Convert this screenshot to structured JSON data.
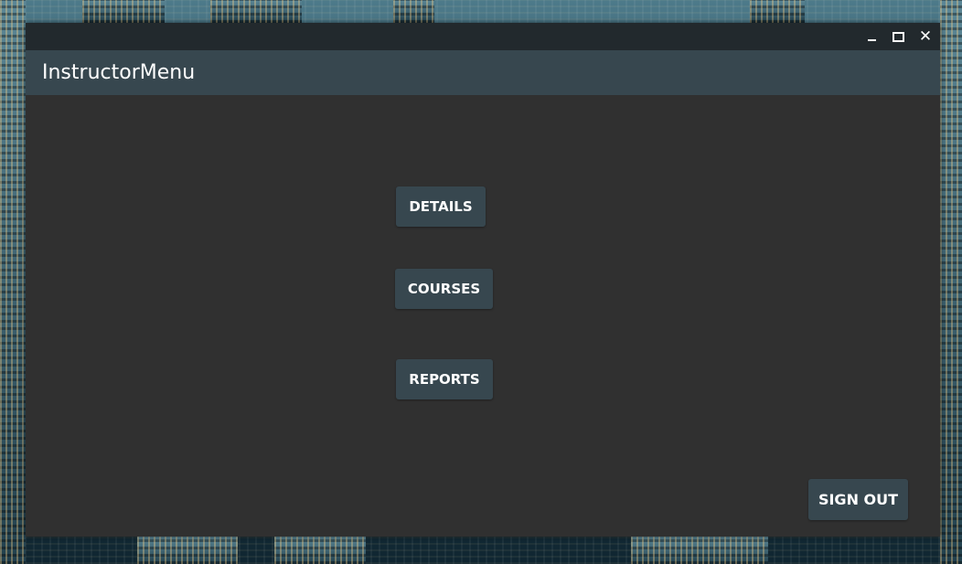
{
  "window": {
    "title": "InstructorMenu",
    "controls": {
      "minimize": "minimize",
      "maximize": "maximize",
      "close": "close"
    }
  },
  "menu": {
    "details_label": "DETAILS",
    "courses_label": "COURSES",
    "reports_label": "REPORTS"
  },
  "footer": {
    "signout_label": "SIGN OUT"
  },
  "colors": {
    "titlebar": "#22292d",
    "appbar": "#37474f",
    "content_background": "#303030",
    "button": "#37474f",
    "text": "#ffffff"
  },
  "icons": {
    "minimize": "minimize-icon",
    "maximize": "maximize-icon",
    "close": "close-icon"
  }
}
